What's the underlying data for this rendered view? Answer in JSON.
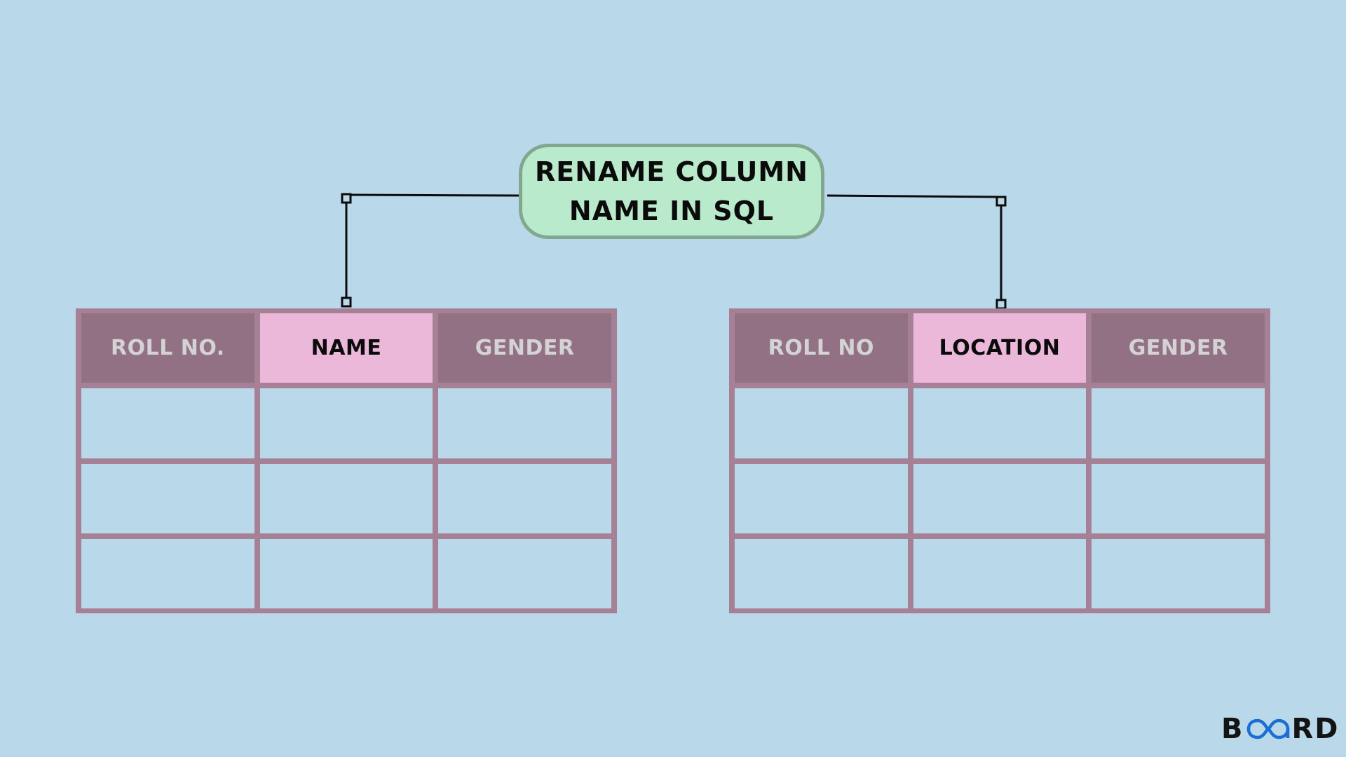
{
  "title": {
    "lines": [
      "RENAME COLUMN",
      "NAME IN SQL"
    ]
  },
  "tables": [
    {
      "headers": [
        "ROLL NO.",
        "NAME",
        "GENDER"
      ],
      "highlighted_column": 1,
      "rows": [
        [
          "",
          "",
          ""
        ],
        [
          "",
          "",
          ""
        ],
        [
          "",
          "",
          ""
        ]
      ]
    },
    {
      "headers": [
        "ROLL NO",
        "LOCATION",
        "GENDER"
      ],
      "highlighted_column": 1,
      "rows": [
        [
          "",
          "",
          ""
        ],
        [
          "",
          "",
          ""
        ],
        [
          "",
          "",
          ""
        ]
      ]
    }
  ],
  "logo": {
    "prefix": "B",
    "icon": "infinity-oa-icon",
    "suffix": "RD"
  },
  "colors": {
    "background": "#b9d8ea",
    "title_fill": "#b8eacb",
    "title_border": "#82a78f",
    "table_border": "#a68196",
    "header_dark": "#937185",
    "header_highlight": "#ecb8d9",
    "logo_accent": "#1a6fd4"
  }
}
